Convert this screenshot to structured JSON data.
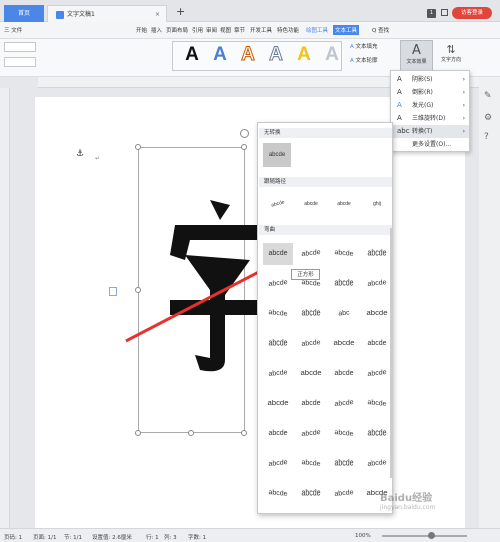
{
  "titlebar": {
    "home_tab": "首页",
    "doc_tab": "文字文稿1",
    "page_badge": "1",
    "login": "访客登录"
  },
  "menu": {
    "file": "三 文件",
    "items": [
      "开始",
      "插入",
      "页面布局",
      "引用",
      "审阅",
      "视图",
      "章节",
      "开发工具",
      "特色功能",
      "绘图工具",
      "文本工具"
    ],
    "search": "Q 查找"
  },
  "ribbon": {
    "wordart_colors": [
      "#111111",
      "#4a7fd4",
      "#f28c28",
      "#9aa8bf",
      "#f2c21a",
      "#bfc5cf"
    ],
    "wordart_letter": "A",
    "text_fill": "文本填充",
    "text_outline": "文本轮廓",
    "text_effects": "文本效果",
    "text_direction": "文字方向"
  },
  "effects_menu": {
    "items": [
      {
        "label": "阴影(S)",
        "icon": "shadow-icon"
      },
      {
        "label": "倒影(R)",
        "icon": "reflection-icon"
      },
      {
        "label": "发光(G)",
        "icon": "glow-icon"
      },
      {
        "label": "三维旋转(D)",
        "icon": "rotation-3d-icon"
      },
      {
        "label": "转换(T)",
        "icon": "transform-icon"
      },
      {
        "label": "更多设置(O)...",
        "icon": ""
      }
    ]
  },
  "transform_panel": {
    "no_transform": "无转换",
    "sample": "abcde",
    "follow_path": "跟随路径",
    "warp": "弯曲",
    "path_samples": [
      "abcde",
      "abcde",
      "abcde",
      "ghij"
    ],
    "warp_rows": [
      [
        "abcde",
        "abcde",
        "abcde",
        "abcde"
      ],
      [
        "abcde",
        "abcde",
        "abcde",
        "abcde"
      ],
      [
        "abcde",
        "abcde",
        "abc",
        "abcde"
      ],
      [
        "abcde",
        "abcde",
        "abcde",
        "abcde"
      ],
      [
        "abcde",
        "abcde",
        "abcde",
        "abcde"
      ],
      [
        "abcde",
        "abcde",
        "abcde",
        "abcde"
      ],
      [
        "abcde",
        "abcde",
        "abcde",
        "abcde"
      ],
      [
        "abcde",
        "abcde",
        "abcde",
        "abcde"
      ],
      [
        "abcde",
        "abcde",
        "abcde",
        "abcde"
      ]
    ],
    "tooltip": "正方形"
  },
  "document": {
    "big_char": "字"
  },
  "statusbar": {
    "page": "页码: 1",
    "pages": "页面: 1/1",
    "section": "节: 1/1",
    "settings": "设置值: 2.6厘米",
    "row": "行: 1",
    "col": "列: 3",
    "words": "字数: 1",
    "zoom": "100%"
  },
  "watermark": {
    "text": "Baidu经验",
    "sub": "jingyan.baidu.com"
  }
}
